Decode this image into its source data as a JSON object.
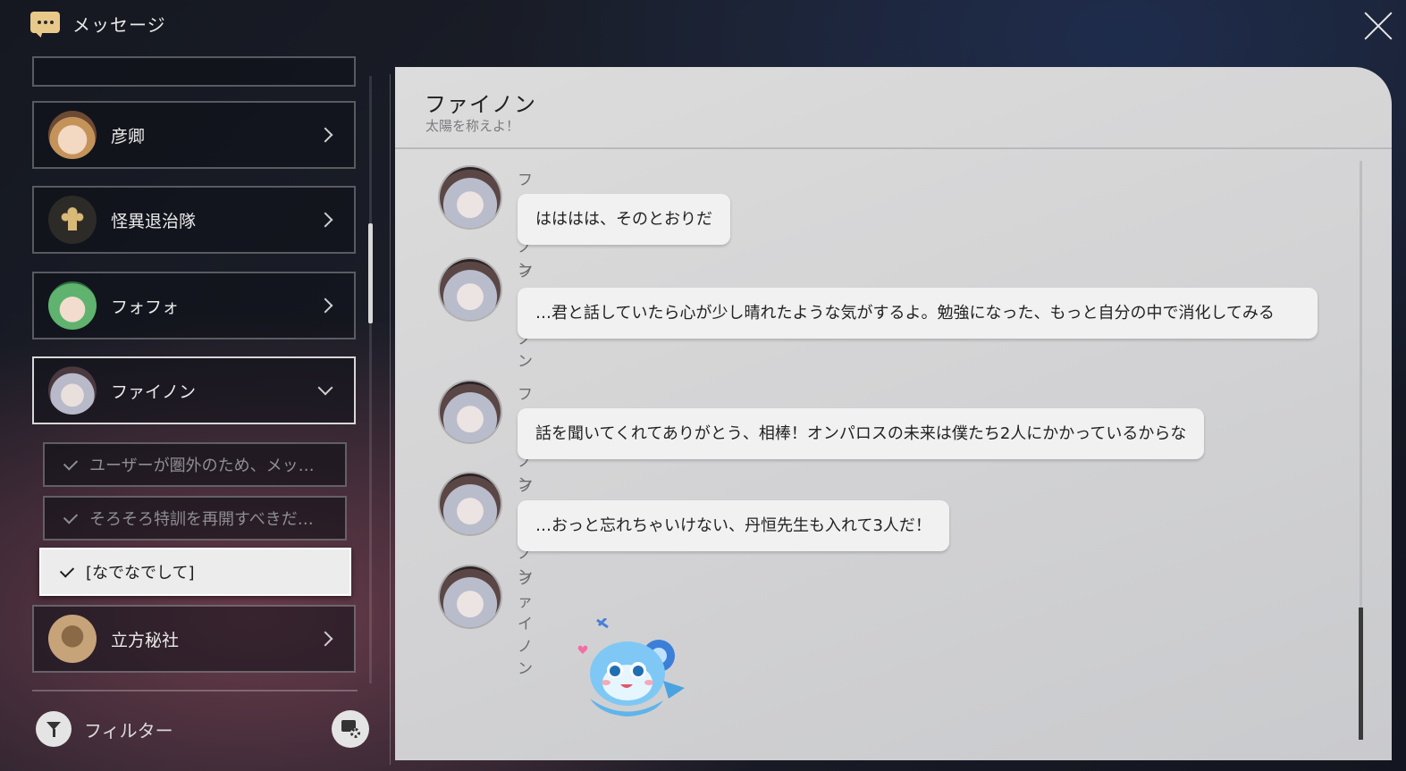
{
  "header": {
    "title": "メッセージ"
  },
  "sidebar": {
    "contacts": [
      {
        "name": "彦卿",
        "avatar_icon": "yanqing-avatar"
      },
      {
        "name": "怪異退治隊",
        "avatar_icon": "group-emblem-avatar"
      },
      {
        "name": "フォフォ",
        "avatar_icon": "huohuo-avatar"
      },
      {
        "name": "ファイノン",
        "avatar_icon": "phainon-avatar"
      },
      {
        "name": "立方秘社",
        "avatar_icon": "silhouette-avatar"
      }
    ],
    "threads": [
      {
        "label": "ユーザーが圏外のため、メッ…"
      },
      {
        "label": "そろそろ特訓を再開すべきだ…"
      },
      {
        "label": "[なでなでして]"
      }
    ],
    "filter_label": "フィルター"
  },
  "chat": {
    "title": "ファイノン",
    "subtitle": "太陽を称えよ！",
    "messages": [
      {
        "sender": "ファイノン",
        "text": "はははは、そのとおりだ"
      },
      {
        "sender": "ファイノン",
        "text": "…君と話していたら心が少し晴れたような気がするよ。勉強になった、もっと自分の中で消化してみる"
      },
      {
        "sender": "ファイノン",
        "text": "話を聞いてくれてありがとう、相棒！オンパロスの未来は僕たち2人にかかっているからな"
      },
      {
        "sender": "ファイノン",
        "text": "…おっと忘れちゃいけない、丹恒先生も入れて3人だ！"
      },
      {
        "sender": "ファイノン",
        "sticker": "blue-creature-sticker"
      }
    ]
  }
}
